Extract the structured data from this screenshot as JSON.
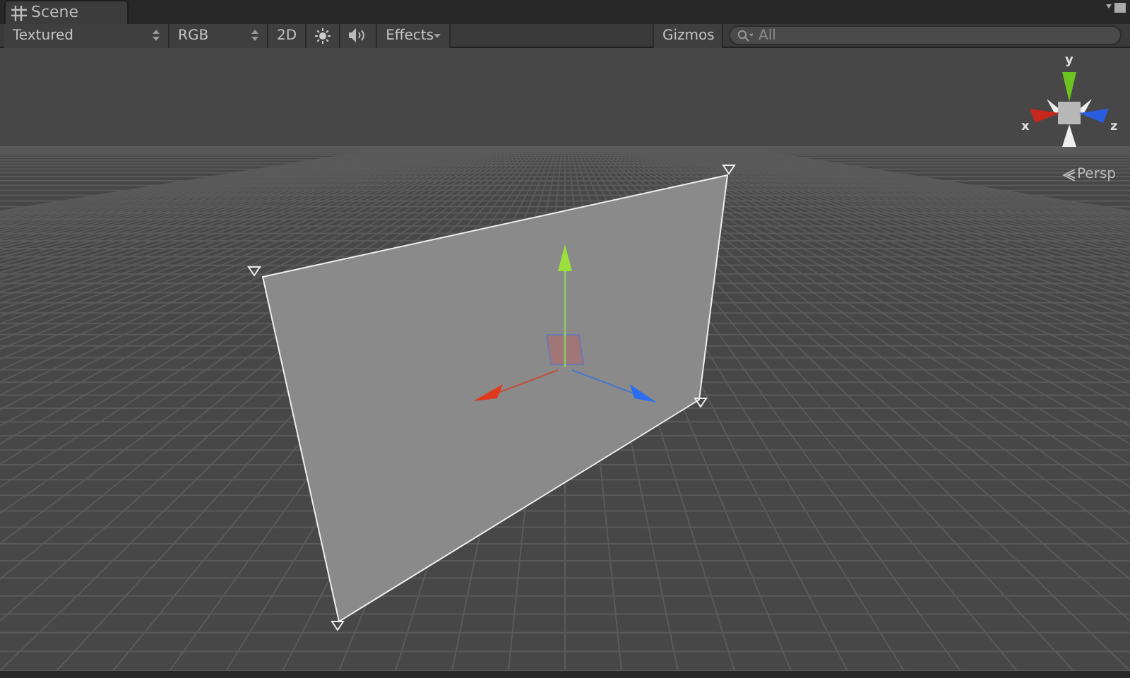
{
  "tabs": [
    {
      "label": "Scene"
    }
  ],
  "toolbar": {
    "draw_mode": "Textured",
    "render_mode": "RGB",
    "toggles": [
      {
        "kind": "dimension",
        "label": "2D",
        "on": false
      },
      {
        "kind": "lighting",
        "on": false
      },
      {
        "kind": "audio",
        "on": false
      }
    ],
    "effects": "Effects",
    "gizmos": "Gizmos",
    "search": {
      "placeholder": "All"
    }
  },
  "orientation_gizmo": {
    "y_label": "y",
    "x_label": "x",
    "z_label": "z",
    "projection": "Persp"
  }
}
